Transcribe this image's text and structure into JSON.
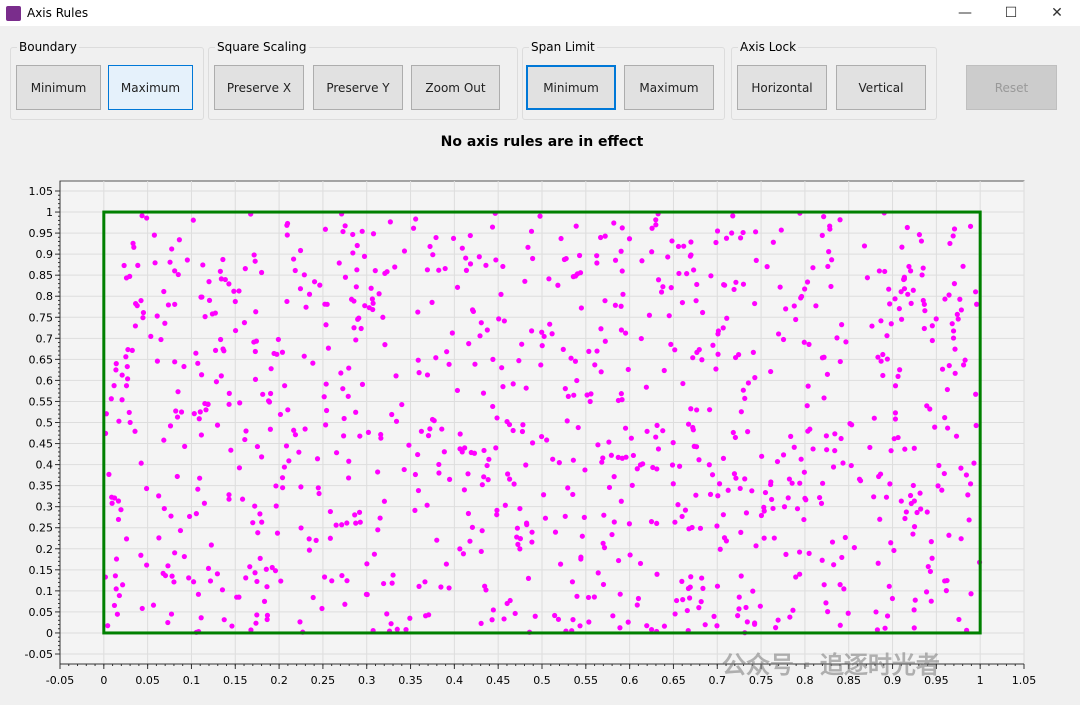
{
  "window": {
    "title": "Axis Rules",
    "minimize": "—",
    "maximize": "☐",
    "close": "✕"
  },
  "groups": [
    {
      "label": "Boundary",
      "buttons": [
        "Minimum",
        "Maximum"
      ]
    },
    {
      "label": "Square Scaling",
      "buttons": [
        "Preserve X",
        "Preserve Y",
        "Zoom Out"
      ]
    },
    {
      "label": "Span Limit",
      "buttons": [
        "Minimum",
        "Maximum"
      ]
    },
    {
      "label": "Axis Lock",
      "buttons": [
        "Horizontal",
        "Vertical"
      ]
    }
  ],
  "reset_label": "Reset",
  "status": "No axis rules are in effect",
  "colors": {
    "points": "#ff00ff",
    "boundary": "#008000"
  },
  "chart_data": {
    "type": "scatter",
    "xlim": [
      -0.05,
      1.05
    ],
    "ylim": [
      -0.05,
      1.05
    ],
    "xticks": [
      "-0.05",
      "0",
      "0.05",
      "0.1",
      "0.15",
      "0.2",
      "0.25",
      "0.3",
      "0.35",
      "0.4",
      "0.45",
      "0.5",
      "0.55",
      "0.6",
      "0.65",
      "0.7",
      "0.75",
      "0.8",
      "0.85",
      "0.9",
      "0.95",
      "1",
      "1.05"
    ],
    "yticks": [
      "-0.05",
      "0",
      "0.05",
      "0.1",
      "0.15",
      "0.2",
      "0.25",
      "0.3",
      "0.35",
      "0.4",
      "0.45",
      "0.5",
      "0.55",
      "0.6",
      "0.65",
      "0.7",
      "0.75",
      "0.8",
      "0.85",
      "0.9",
      "0.95",
      "1",
      "1.05"
    ],
    "boundary_rect": {
      "x": [
        0,
        1
      ],
      "y": [
        0,
        1
      ]
    },
    "point_count": 1000,
    "point_distribution": "uniform random in [0,1]x[0,1]",
    "grid": true
  },
  "watermark": "公众号 · 追逐时光者"
}
